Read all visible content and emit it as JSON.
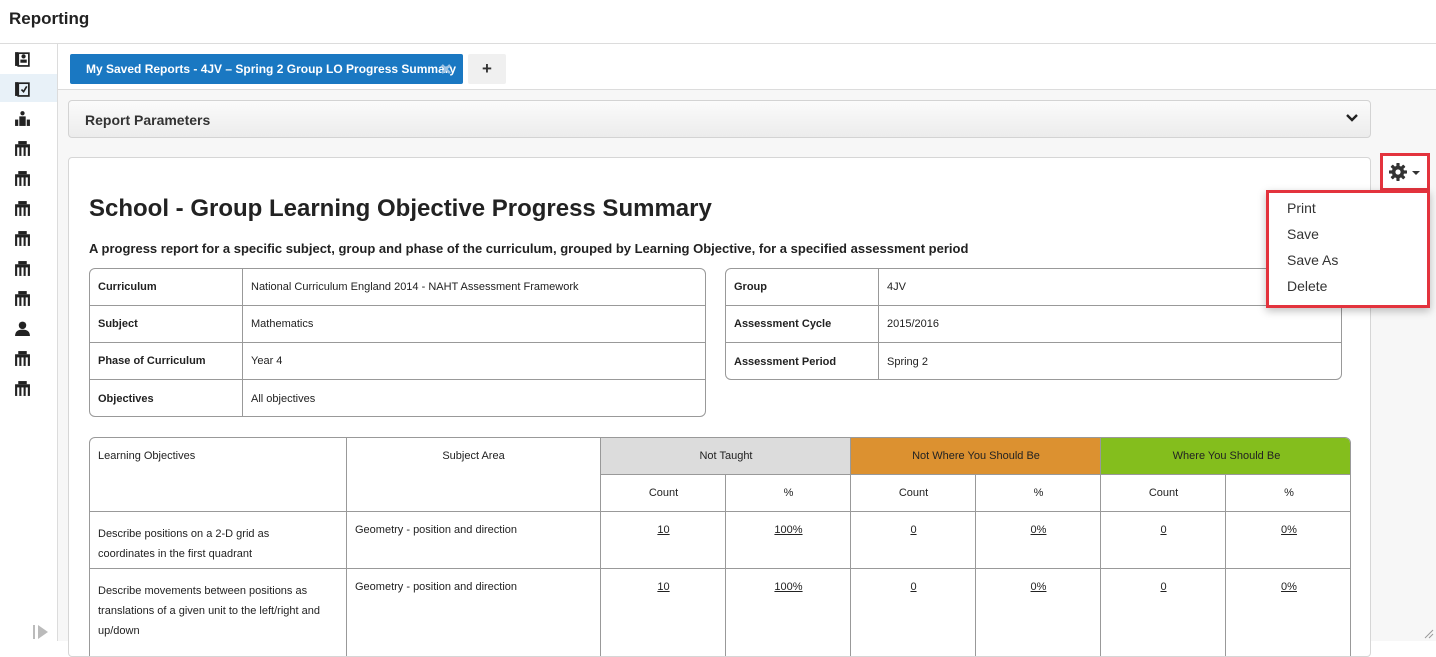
{
  "app": {
    "title": "Reporting"
  },
  "sidebar": {
    "items": [
      {
        "icon": "report-person-icon",
        "active": false
      },
      {
        "icon": "report-check-icon",
        "active": true
      },
      {
        "icon": "school-hierarchy-icon",
        "active": false
      },
      {
        "icon": "school-building-icon",
        "active": false
      },
      {
        "icon": "school-building-icon",
        "active": false
      },
      {
        "icon": "school-building-icon",
        "active": false
      },
      {
        "icon": "school-building-icon",
        "active": false
      },
      {
        "icon": "school-building-icon",
        "active": false
      },
      {
        "icon": "school-building-icon",
        "active": false
      },
      {
        "icon": "person-icon",
        "active": false
      },
      {
        "icon": "school-building-icon",
        "active": false
      },
      {
        "icon": "school-building-icon",
        "active": false
      }
    ]
  },
  "tabs": {
    "active_label": "My Saved Reports - 4JV – Spring 2 Group LO Progress Summary",
    "add_label": "+"
  },
  "params": {
    "title": "Report Parameters"
  },
  "report": {
    "title": "School - Group Learning Objective Progress Summary",
    "subtitle": "A progress report for a specific subject, group and phase of the curriculum, grouped by Learning Objective, for a specified assessment period",
    "left_info": [
      {
        "label": "Curriculum",
        "value": "National Curriculum England 2014 - NAHT Assessment Framework"
      },
      {
        "label": "Subject",
        "value": "Mathematics"
      },
      {
        "label": "Phase of Curriculum",
        "value": "Year 4"
      },
      {
        "label": "Objectives",
        "value": "All objectives"
      }
    ],
    "right_info": [
      {
        "label": "Group",
        "value": "4JV"
      },
      {
        "label": "Assessment Cycle",
        "value": "2015/2016"
      },
      {
        "label": "Assessment Period",
        "value": "Spring 2"
      }
    ],
    "table": {
      "col_learning_objectives": "Learning Objectives",
      "col_subject_area": "Subject Area",
      "groups": [
        {
          "label": "Not Taught",
          "color": "#dcdcdc"
        },
        {
          "label": "Not Where You Should Be",
          "color": "#dc9130"
        },
        {
          "label": "Where You Should Be",
          "color": "#84be1d"
        }
      ],
      "sub_count": "Count",
      "sub_pct": "%",
      "rows": [
        {
          "objective": "Describe positions on a 2-D grid as coordinates in the first quadrant",
          "area": "Geometry - position and direction",
          "values": [
            "10",
            "100%",
            "0",
            "0%",
            "0",
            "0%"
          ]
        },
        {
          "objective": "Describe movements between positions as translations of a given unit to the left/right and up/down",
          "area": "Geometry - position and direction",
          "values": [
            "10",
            "100%",
            "0",
            "0%",
            "0",
            "0%"
          ]
        }
      ]
    }
  },
  "menu": {
    "gear_icon": "gear-icon",
    "items": [
      "Print",
      "Save",
      "Save As",
      "Delete"
    ],
    "highlight_color": "#e3333d"
  }
}
